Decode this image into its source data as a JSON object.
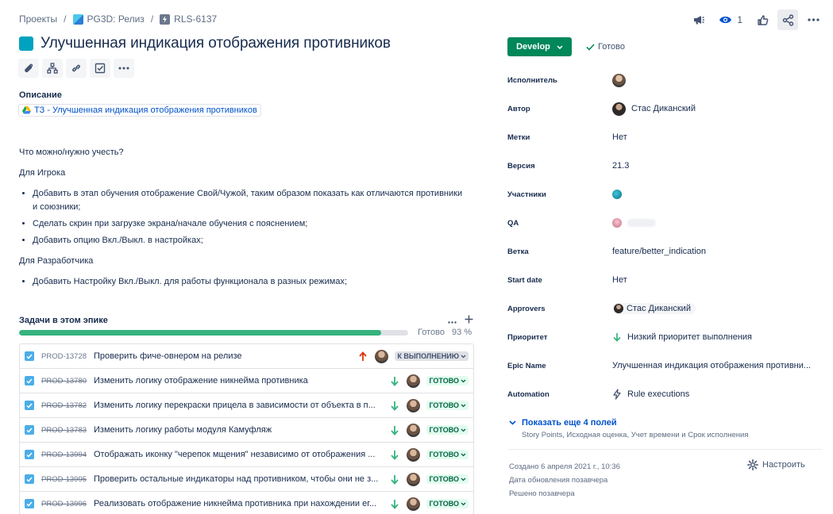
{
  "breadcrumb": {
    "projects": "Проекты",
    "project": "PG3D: Релиз",
    "issue_key": "RLS-6137"
  },
  "header": {
    "watchers_count": "1",
    "title": "Улучшенная индикация отображения противников"
  },
  "icons": {
    "epic": "epic-square-icon",
    "attach": "paperclip-icon",
    "child": "hierarchy-icon",
    "link": "link-icon",
    "checklist": "checkbox-icon",
    "more": "more-icon",
    "announce": "megaphone-icon",
    "watch": "eye-icon",
    "like": "thumbs-up-icon",
    "share": "share-icon"
  },
  "description": {
    "heading": "Описание",
    "doc_link": "ТЗ - Улучшенная индикация отображения противников",
    "question": "Что можно/нужно учесть?",
    "player_heading": "Для Игрока",
    "player_items": [
      "Добавить в этап обучения отображение Свой/Чужой, таким образом показать как отличаются противники и союзники;",
      "Сделать скрин при загрузке экрана/начале обучения с пояснением;",
      "Добавить опцию Вкл./Выкл. в настройках;"
    ],
    "dev_heading": "Для Разработчика",
    "dev_items": [
      "Добавить Настройку Вкл./Выкл. для работы функционала в разных режимах;"
    ]
  },
  "epic_tasks": {
    "heading": "Задачи в этом эпике",
    "progress_label": "Готово",
    "progress_percent": "93 %",
    "progress_value": 0.93,
    "tasks": [
      {
        "key": "PROD-13728",
        "summary": "Проверить фиче-овнером на релизе",
        "priority": "high",
        "status": "К ВЫПОЛНЕНИЮ",
        "done": false
      },
      {
        "key": "PROD-13780",
        "summary": "Изменить логику отображение никнейма противника",
        "priority": "low",
        "status": "ГОТОВО",
        "done": true
      },
      {
        "key": "PROD-13782",
        "summary": "Изменить логику перекраски прицела в зависимости от объекта в п...",
        "priority": "low",
        "status": "ГОТОВО",
        "done": true
      },
      {
        "key": "PROD-13783",
        "summary": "Изменить логику работы модуля Камуфляж",
        "priority": "low",
        "status": "ГОТОВО",
        "done": true
      },
      {
        "key": "PROD-13994",
        "summary": "Отображать иконку \"черепок мщения\" независимо от отображения ...",
        "priority": "low",
        "status": "ГОТОВО",
        "done": true
      },
      {
        "key": "PROD-13995",
        "summary": "Проверить остальные индикаторы над противником, чтобы они не з...",
        "priority": "low",
        "status": "ГОТОВО",
        "done": true
      },
      {
        "key": "PROD-13996",
        "summary": "Реализовать отображение никнейма противника при нахождении ег...",
        "priority": "low",
        "status": "ГОТОВО",
        "done": true
      }
    ]
  },
  "status": {
    "button": "Develop",
    "resolution": "Готово"
  },
  "fields": {
    "assignee_label": "Исполнитель",
    "author_label": "Автор",
    "author_value": "Стас Диканский",
    "labels_label": "Метки",
    "labels_value": "Нет",
    "version_label": "Версия",
    "version_value": "21.3",
    "participants_label": "Участники",
    "qa_label": "QA",
    "branch_label": "Ветка",
    "branch_value": "feature/better_indication",
    "start_date_label": "Start date",
    "start_date_value": "Нет",
    "approvers_label": "Approvers",
    "approvers_value": "Стас Диканский",
    "priority_label": "Приоритет",
    "priority_value": "Низкий приоритет выполнения",
    "epic_name_label": "Epic Name",
    "epic_name_value": "Улучшенная индикация отображения противни...",
    "automation_label": "Automation",
    "automation_value": "Rule executions"
  },
  "more_fields": {
    "label": "Показать еще 4 полей",
    "sub": "Story Points, Исходная оценка, Учет времени и Срок исполнения"
  },
  "meta": {
    "created": "Создано 6 апреля 2021 г., 10:36",
    "updated": "Дата обновления позавчера",
    "resolved": "Решено позавчера",
    "configure": "Настроить"
  },
  "colors": {
    "develop": "#00875a",
    "progress": "#36b37e",
    "epic": "#00a3bf",
    "link": "#0052cc",
    "high_priority": "#de350b",
    "low_priority": "#36b37e"
  }
}
